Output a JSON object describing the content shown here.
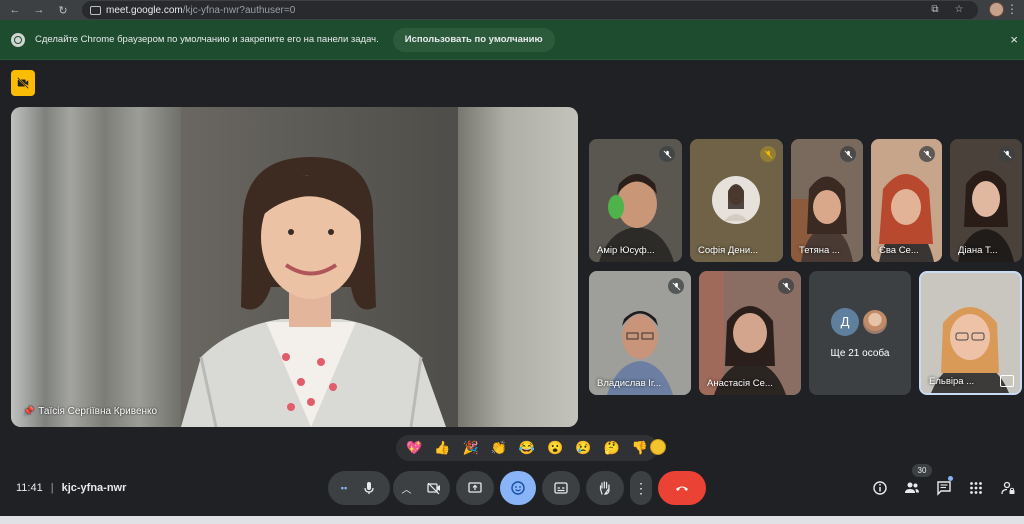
{
  "browser": {
    "url_host": "meet.google.com",
    "url_path": "/kjc-yfna-nwr?authuser=0"
  },
  "infobar": {
    "message": "Сделайте Chrome браузером по умолчанию и закрепите его на панели задач.",
    "button_label": "Использовать по умолчанию",
    "close_label": "×"
  },
  "main_speaker": {
    "name": "Таїсія Сергіївна Кривенко"
  },
  "participants": [
    {
      "name": "Амір Юсуф...",
      "bg": "#4c4a43"
    },
    {
      "name": "Софія Дени...",
      "bg": "#74664a"
    },
    {
      "name": "Тетяна ...",
      "bg": "#6b5446"
    },
    {
      "name": "Єва Се...",
      "bg": "#b88b6f"
    },
    {
      "name": "Діана Т...",
      "bg": "#3f3833"
    },
    {
      "name": "Владислав Іг...",
      "bg": "#8b8b8b"
    },
    {
      "name": "Анастасія Се...",
      "bg": "#6d4e48"
    },
    {
      "name": "Ельвіра ...",
      "bg": "#b7b3ad"
    }
  ],
  "more": {
    "letter": "Д",
    "label": "Ще 21 особа"
  },
  "reactions": [
    "💖",
    "👍",
    "🎉",
    "👏",
    "😂",
    "😮",
    "😢",
    "🤔",
    "👎"
  ],
  "meeting": {
    "time": "11:41",
    "separator": "|",
    "code": "kjc-yfna-nwr"
  },
  "people_count": "30",
  "colors": {
    "end_call": "#ea4335",
    "active_control": "#8ab4f8",
    "cam_off_badge": "#fbbc04",
    "infobar_bg": "#1e4c2e"
  }
}
